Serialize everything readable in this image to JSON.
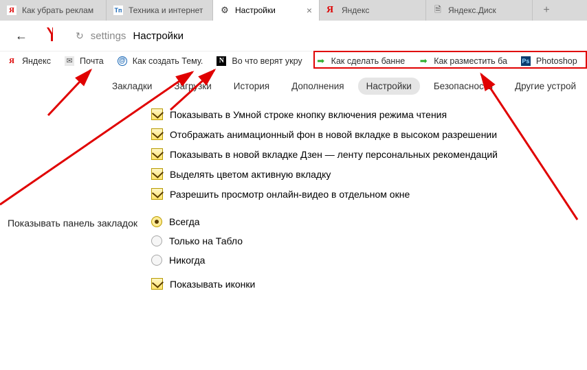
{
  "tabs": [
    {
      "title": "Как убрать реклам",
      "icon": "ya"
    },
    {
      "title": "Техника и интернет",
      "icon": "tp"
    },
    {
      "title": "Настройки",
      "icon": "gear",
      "active": true
    },
    {
      "title": "Яндекс",
      "icon": "ya-red"
    },
    {
      "title": "Яндекс.Диск",
      "icon": "doc"
    }
  ],
  "nav": {
    "address_path": "settings",
    "address_page": "Настройки"
  },
  "bookmarks": [
    {
      "icon": "ya",
      "label": "Яндекс"
    },
    {
      "icon": "mail",
      "label": "Почта"
    },
    {
      "icon": "at",
      "label": "Как создать Тему."
    },
    {
      "icon": "n",
      "label": "Во что верят укру"
    },
    {
      "icon": "arr",
      "label": "Как сделать банне",
      "hl": true
    },
    {
      "icon": "arr",
      "label": "Как разместить ба",
      "hl": true
    },
    {
      "icon": "ps",
      "label": "Photoshop",
      "hl": true
    }
  ],
  "subnav": {
    "items": [
      "Закладки",
      "Загрузки",
      "История",
      "Дополнения",
      "Настройки",
      "Безопасность",
      "Другие устрой"
    ],
    "active_index": 4
  },
  "settings": {
    "checks": [
      "Показывать в Умной строке кнопку включения режима чтения",
      "Отображать анимационный фон в новой вкладке в высоком разрешении",
      "Показывать в новой вкладке Дзен — ленту персональных рекомендаций",
      "Выделять цветом активную вкладку",
      "Разрешить просмотр онлайн-видео в отдельном окне"
    ],
    "bm_panel": {
      "label": "Показывать панель закладок",
      "radios": [
        "Всегда",
        "Только на Табло",
        "Никогда"
      ],
      "selected": 0,
      "extra_check": "Показывать иконки"
    }
  }
}
